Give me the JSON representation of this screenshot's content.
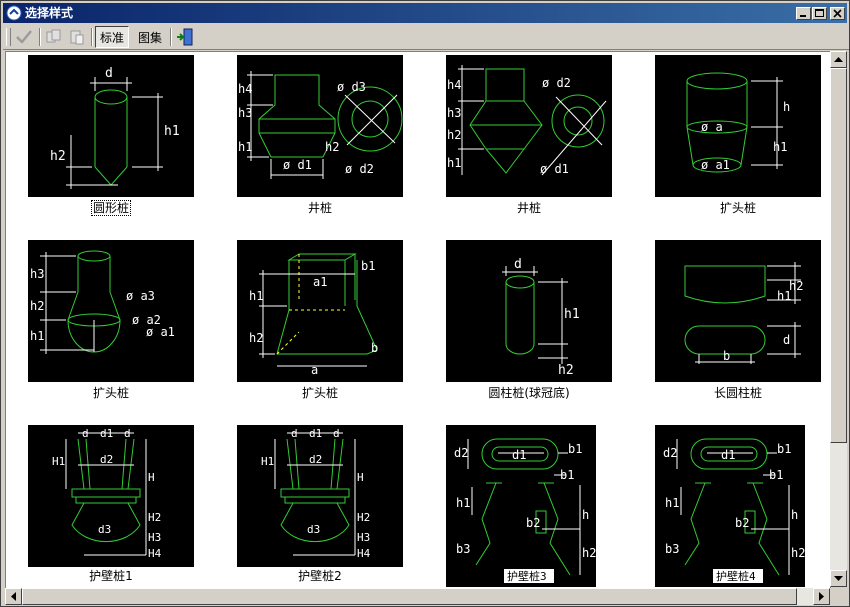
{
  "window": {
    "title": "选择样式"
  },
  "toolbar": {
    "tab_standard": "标准",
    "tab_atlas": "图集"
  },
  "items": [
    {
      "caption": "圆形桩"
    },
    {
      "caption": "井桩"
    },
    {
      "caption": "井桩"
    },
    {
      "caption": "扩头桩"
    },
    {
      "caption": "扩头桩"
    },
    {
      "caption": "扩头桩"
    },
    {
      "caption": "圆柱桩(球冠底)"
    },
    {
      "caption": "长圆柱桩"
    },
    {
      "caption": "护壁桩1"
    },
    {
      "caption": "护壁桩2"
    },
    {
      "caption": "护壁桩3"
    },
    {
      "caption": "护壁桩4"
    }
  ],
  "labels": {
    "d": "d",
    "d1": "d1",
    "d2": "d2",
    "d3": "d3",
    "h": "h",
    "h1": "h1",
    "h2": "h2",
    "h3": "h3",
    "h4": "h4",
    "H": "H",
    "H1": "H1",
    "H2": "H2",
    "H3": "H3",
    "H4": "H4",
    "a": "a",
    "a1": "a1",
    "b": "b",
    "b1": "b1",
    "b2": "b2",
    "b3": "b3",
    "phi_a": "ø a",
    "phi_a1": "ø a1",
    "phi_a2": "ø a2",
    "phi_a3": "ø a3",
    "phi_d1": "ø d1",
    "phi_d2": "ø d2",
    "phi_d3": "ø d3"
  },
  "colors": {
    "shape": "#33cc33",
    "dim": "#ffffff",
    "accent": "#ffff33",
    "titlebar": "#0a246a"
  }
}
